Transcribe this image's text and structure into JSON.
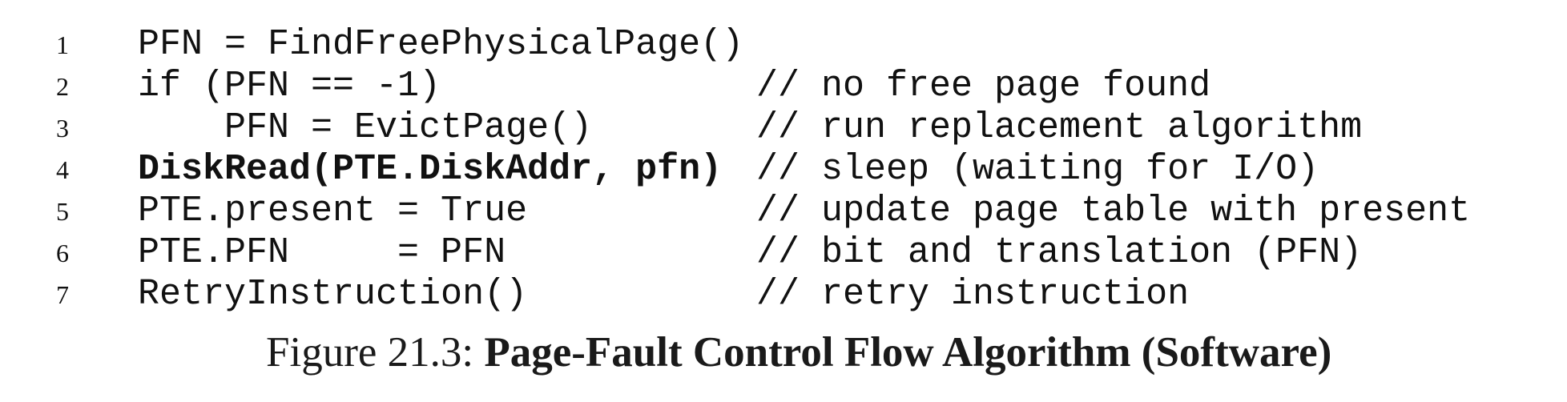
{
  "code_lines": [
    {
      "number": "1",
      "code": "PFN = FindFreePhysicalPage()",
      "comment": ""
    },
    {
      "number": "2",
      "code": "if (PFN == -1)",
      "comment": "// no free page found"
    },
    {
      "number": "3",
      "code": "    PFN = EvictPage()",
      "comment": "// run replacement algorithm"
    },
    {
      "number": "4",
      "code": "DiskRead(PTE.DiskAddr, pfn)",
      "comment": "// sleep (waiting for I/O)"
    },
    {
      "number": "5",
      "code": "PTE.present = True",
      "comment": "// update page table with present"
    },
    {
      "number": "6",
      "code": "PTE.PFN     = PFN",
      "comment": "// bit and translation (PFN)"
    },
    {
      "number": "7",
      "code": "RetryInstruction()",
      "comment": "// retry instruction"
    }
  ],
  "caption": {
    "label": "Figure 21.3:",
    "title": "Page-Fault Control Flow Algorithm (Software)"
  }
}
